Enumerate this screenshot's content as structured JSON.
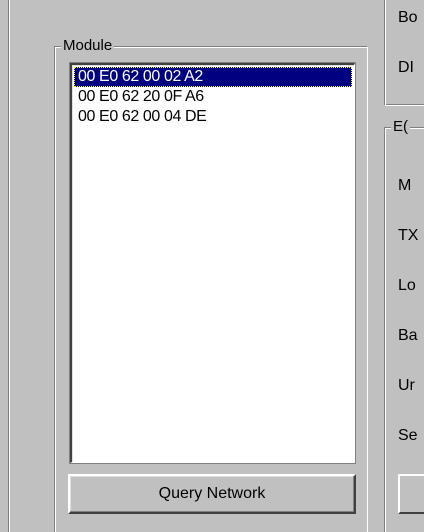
{
  "module_group": {
    "legend": "Module",
    "items": [
      {
        "label": "00 E0 62 00 02 A2",
        "selected": true
      },
      {
        "label": "00 E0 62 20 0F A6",
        "selected": false
      },
      {
        "label": "00 E0 62 00 04 DE",
        "selected": false
      }
    ],
    "query_button_label": "Query Network"
  },
  "right_panel": {
    "top_labels": [
      "Bo",
      "DI"
    ],
    "lower_group_legend": "E(",
    "lower_labels": [
      "M",
      "TX",
      "Lo",
      "Ba",
      "Ur",
      "Se"
    ]
  }
}
